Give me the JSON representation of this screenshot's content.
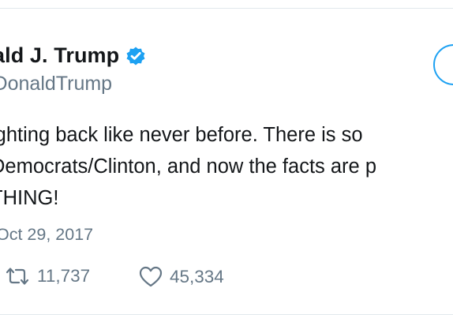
{
  "tweet": {
    "display_name": "ald J. Trump",
    "handle": "lDonaldTrump",
    "lines": [
      "ighting back like never before. There is so",
      "Democrats/Clinton, and now the facts are p",
      "THING!"
    ],
    "timestamp": "Oct 29, 2017",
    "retweet_count": "11,737",
    "like_count": "45,334"
  },
  "icons": {
    "verified": "verified-badge-icon",
    "retweet": "retweet-icon",
    "like": "heart-icon"
  },
  "colors": {
    "accent": "#1da1f2",
    "text": "#14171a",
    "muted": "#657786",
    "border": "#e1e8ed"
  }
}
